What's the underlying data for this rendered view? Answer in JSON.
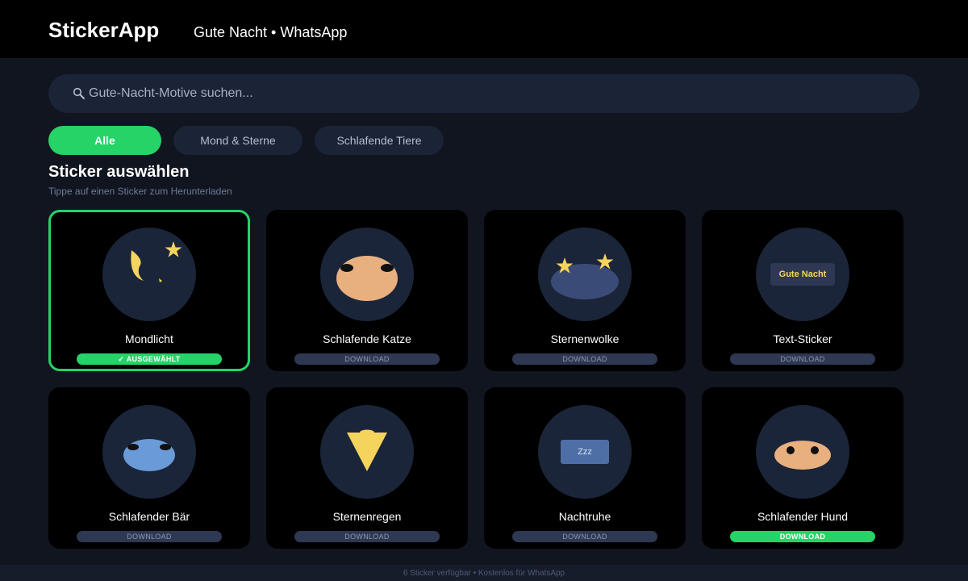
{
  "app": {
    "brand": "StickerApp",
    "subtitle": "Gute Nacht • WhatsApp"
  },
  "search": {
    "placeholder": "Gute-Nacht-Motive suchen..."
  },
  "filters": [
    {
      "label": "Alle",
      "active": true
    },
    {
      "label": "Mond & Sterne",
      "active": false
    },
    {
      "label": "Schlafende Tiere",
      "active": false
    }
  ],
  "section": {
    "title": "Sticker auswählen",
    "hint": "Tippe auf einen Sticker zum Herunterladen"
  },
  "stickers": [
    {
      "name": "Mondlicht",
      "button": "✓ AUSGEWÄHLT",
      "selected": true
    },
    {
      "name": "Schlafende Katze",
      "button": "DOWNLOAD",
      "selected": false
    },
    {
      "name": "Sternenwolke",
      "button": "DOWNLOAD",
      "selected": false
    },
    {
      "name": "Text-Sticker",
      "button": "DOWNLOAD",
      "selected": false,
      "art_text": "Gute Nacht"
    },
    {
      "name": "Schlafender Bär",
      "button": "DOWNLOAD",
      "selected": false
    },
    {
      "name": "Sternenregen",
      "button": "DOWNLOAD",
      "selected": false
    },
    {
      "name": "Nachtruhe",
      "button": "DOWNLOAD",
      "selected": false,
      "art_text": "Zzz"
    },
    {
      "name": "Schlafender Hund",
      "button": "DOWNLOAD",
      "selected": false,
      "highlight": true
    }
  ],
  "footer": {
    "text": "6 Sticker verfügbar • Kostenlos für WhatsApp"
  },
  "colors": {
    "accent": "#25d366",
    "background": "#111520",
    "card": "#000000",
    "circle": "#1b2539",
    "star": "#f5d45e"
  }
}
